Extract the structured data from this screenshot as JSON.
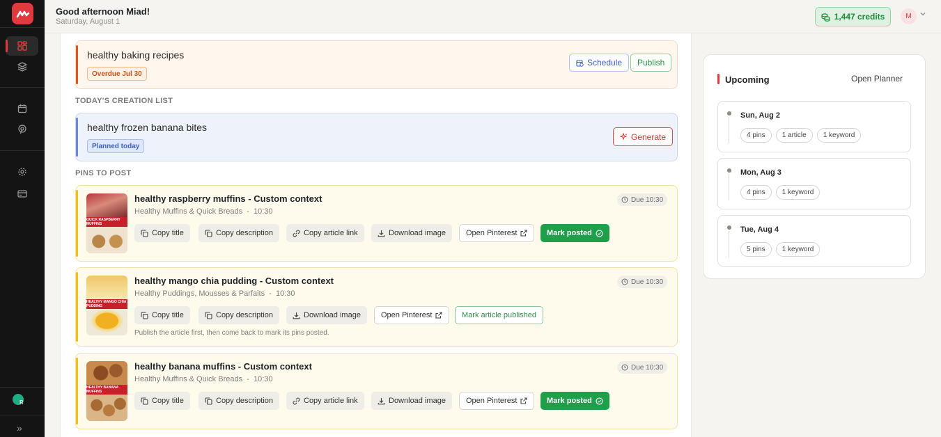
{
  "app": {
    "brand_color": "#e03a3e"
  },
  "header": {
    "greeting": "Good afternoon Miad!",
    "date": "Saturday, August 1",
    "credits": "1,447  credits",
    "user_initial": "M"
  },
  "sidebar": {
    "items": [
      {
        "name": "dashboard",
        "icon": "dashboard-grid-icon",
        "active": true
      },
      {
        "name": "layers",
        "icon": "layers-icon"
      },
      {
        "name": "calendar",
        "icon": "calendar-icon"
      },
      {
        "name": "pinterest",
        "icon": "pinterest-icon"
      },
      {
        "name": "settings",
        "icon": "gear-icon"
      },
      {
        "name": "billing",
        "icon": "credit-card-icon"
      }
    ],
    "user_initial": "R"
  },
  "overdue": {
    "title": "healthy baking recipes",
    "badge": "Overdue Jul 30",
    "schedule_label": "Schedule",
    "publish_label": "Publish"
  },
  "creation": {
    "section_label": "TODAY'S CREATION LIST",
    "title": "healthy frozen banana bites",
    "badge": "Planned today",
    "generate_label": "Generate"
  },
  "pins": {
    "section_label": "PINS TO POST",
    "items": [
      {
        "title": "healthy raspberry muffins - Custom context",
        "board": "Healthy Muffins & Quick Breads",
        "time": "10:30",
        "due": "Due 10:30",
        "thumb_text": "QUICK RASPBERRY MUFFINS",
        "copy_title": "Copy title",
        "copy_description": "Copy description",
        "copy_article_link": "Copy article link",
        "download_image": "Download image",
        "open_pinterest": "Open Pinterest",
        "mark_posted": "Mark posted"
      },
      {
        "title": "healthy mango chia pudding - Custom context",
        "board": "Healthy Puddings, Mousses & Parfaits",
        "time": "10:30",
        "due": "Due 10:30",
        "thumb_text": "HEALTHY MANGO CHIA PUDDING",
        "copy_title": "Copy title",
        "copy_description": "Copy description",
        "download_image": "Download image",
        "open_pinterest": "Open Pinterest",
        "mark_article_published": "Mark article published",
        "note": "Publish the article first, then come back to mark its pins posted."
      },
      {
        "title": "healthy banana muffins - Custom context",
        "board": "Healthy Muffins & Quick Breads",
        "time": "10:30",
        "due": "Due 10:30",
        "thumb_text": "HEALTHY BANANA MUFFINS",
        "copy_title": "Copy title",
        "copy_description": "Copy description",
        "copy_article_link": "Copy article link",
        "download_image": "Download image",
        "open_pinterest": "Open Pinterest",
        "mark_posted": "Mark posted"
      }
    ]
  },
  "upcoming": {
    "title": "Upcoming",
    "open_planner": "Open Planner",
    "days": [
      {
        "label": "Sun, Aug 2",
        "chips": [
          "4 pins",
          "1 article",
          "1 keyword"
        ]
      },
      {
        "label": "Mon, Aug 3",
        "chips": [
          "4 pins",
          "1 keyword"
        ]
      },
      {
        "label": "Tue, Aug 4",
        "chips": [
          "5 pins",
          "1 keyword"
        ]
      }
    ]
  }
}
